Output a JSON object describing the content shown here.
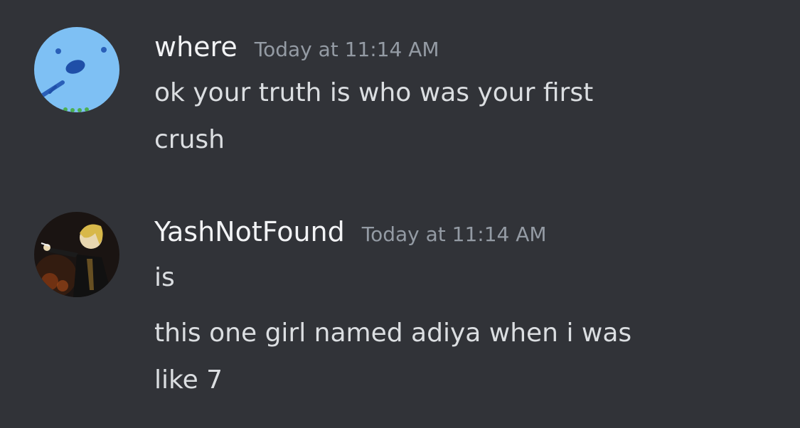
{
  "messages": [
    {
      "author": "where",
      "timestamp": "Today at 11:14 AM",
      "lines": [
        "ok your truth is who was your first",
        "crush"
      ],
      "avatar_icon": "blue-blob-face-avatar"
    },
    {
      "author": "YashNotFound",
      "timestamp": "Today at 11:14 AM",
      "lines": [
        "is",
        "this one girl named adiya when i was",
        "like 7"
      ],
      "avatar_icon": "anime-character-avatar"
    }
  ],
  "colors": {
    "background": "#313338",
    "username": "#f2f3f5",
    "timestamp": "#949ba4",
    "message_text": "#dbdee1",
    "avatar1_bg": "#7ec0f4"
  }
}
